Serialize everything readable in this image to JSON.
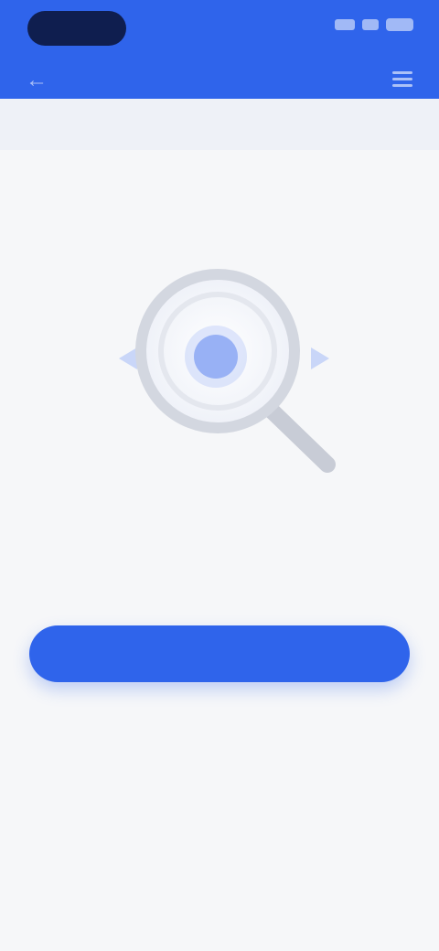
{
  "colors": {
    "accent": "#2f64eb",
    "header_bg": "#2f64eb",
    "page_bg": "#f6f7f9",
    "title_text": "#222a38",
    "muted_text": "#9aa2b1"
  },
  "icons": {
    "back": "arrow-left-icon",
    "menu": "menu-icon",
    "illustration": "magnifier-search-icon"
  },
  "header": {
    "title": "",
    "subtitle": ""
  },
  "empty_state": {
    "title": "",
    "description": ""
  },
  "actions": {
    "primary_label": ""
  }
}
